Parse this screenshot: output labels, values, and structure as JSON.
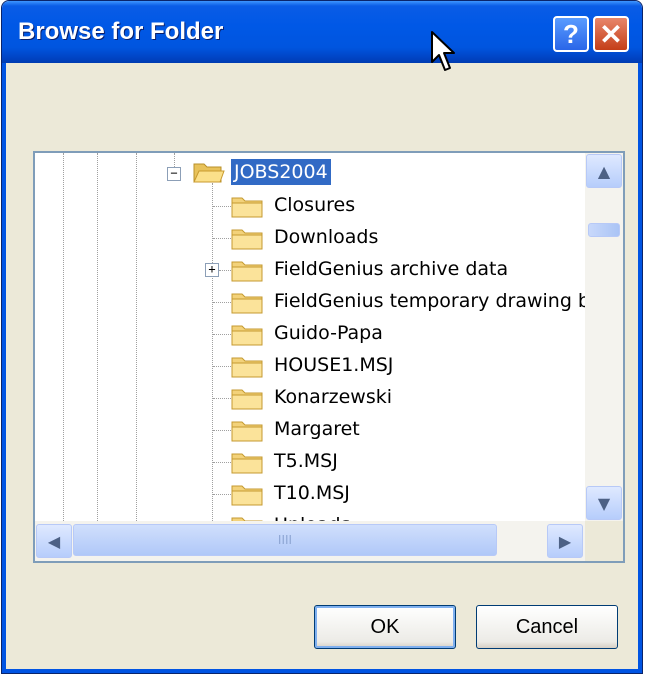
{
  "window": {
    "title": "Browse for Folder",
    "help_glyph": "?",
    "close_glyph": "✕"
  },
  "tree": {
    "root": {
      "label": "JOBS2004",
      "expander": "−"
    },
    "items": [
      {
        "label": "Closures"
      },
      {
        "label": "Downloads"
      },
      {
        "label": "FieldGenius archive data",
        "expander": "+"
      },
      {
        "label": "FieldGenius temporary drawing b"
      },
      {
        "label": "Guido-Papa"
      },
      {
        "label": "HOUSE1.MSJ"
      },
      {
        "label": "Konarzewski"
      },
      {
        "label": "Margaret"
      },
      {
        "label": "T5.MSJ"
      },
      {
        "label": "T10.MSJ"
      },
      {
        "label": "Uploads"
      }
    ]
  },
  "scrollbars": {
    "up": "▲",
    "down": "▼",
    "left": "◀",
    "right": "▶",
    "grip": "IIII"
  },
  "buttons": {
    "ok": "OK",
    "cancel": "Cancel"
  },
  "colors": {
    "titlebar": "#0058e6",
    "selection": "#316ac5",
    "dialog_bg": "#ece9d8"
  }
}
